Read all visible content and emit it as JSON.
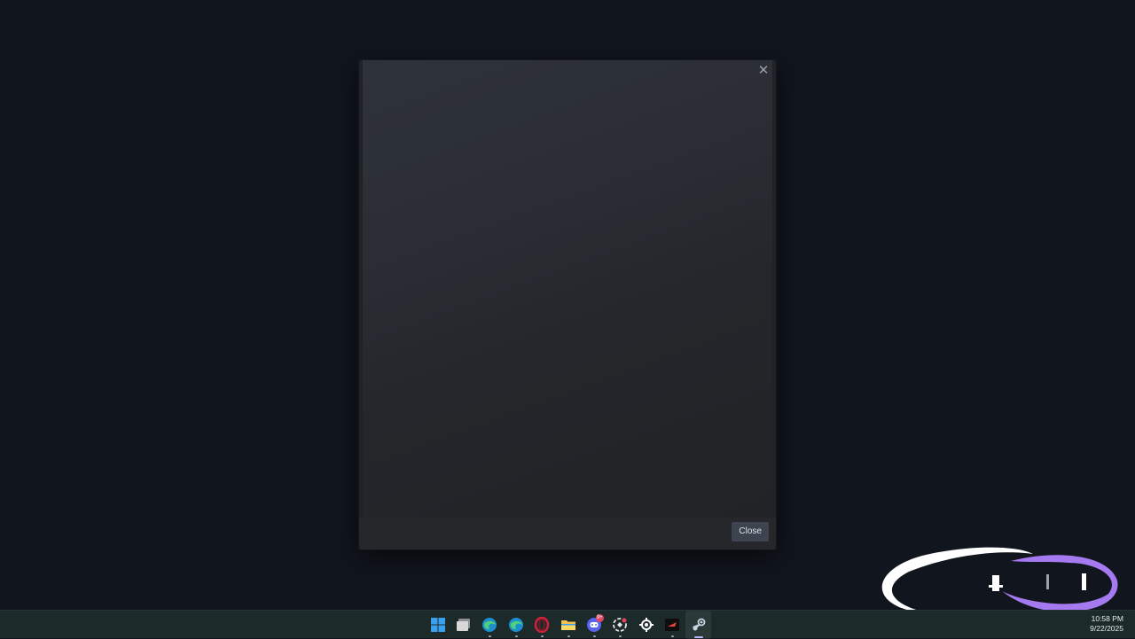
{
  "dialog": {
    "close_x_icon": "close-icon",
    "close_label": "Close"
  },
  "taskbar": {
    "icons": [
      {
        "name": "start-icon",
        "label": "Start",
        "color": "#3aa0f0"
      },
      {
        "name": "task-view-icon",
        "label": "Task View",
        "color": "#c8c8c8"
      },
      {
        "name": "edge-icon",
        "label": "Microsoft Edge",
        "color": "#2fb0c8"
      },
      {
        "name": "edge-icon",
        "label": "Microsoft Edge",
        "color": "#2fb0c8"
      },
      {
        "name": "opera-icon",
        "label": "Opera",
        "color": "#d0203a"
      },
      {
        "name": "file-explorer-icon",
        "label": "File Explorer",
        "color": "#f2c14e"
      },
      {
        "name": "discord-icon",
        "label": "Discord",
        "color": "#5865f2",
        "badge": "9+"
      },
      {
        "name": "app-icon",
        "label": "App",
        "color": "#e6e6e6"
      },
      {
        "name": "steelseries-icon",
        "label": "SteelSeries",
        "color": "#ffffff"
      },
      {
        "name": "app-red-icon",
        "label": "App",
        "color": "#e8463c"
      },
      {
        "name": "steam-icon",
        "label": "Steam",
        "color": "#c7d5e0",
        "active": true
      }
    ],
    "clock": {
      "time": "10:58 PM",
      "date": "9/22/2025"
    }
  },
  "colors": {
    "desktop_bg": "#11151d",
    "dialog_bg": "#202226",
    "button_bg": "#3d4450",
    "taskbar_bg": "#1c2b2a",
    "accent": "#b9b6ff"
  }
}
